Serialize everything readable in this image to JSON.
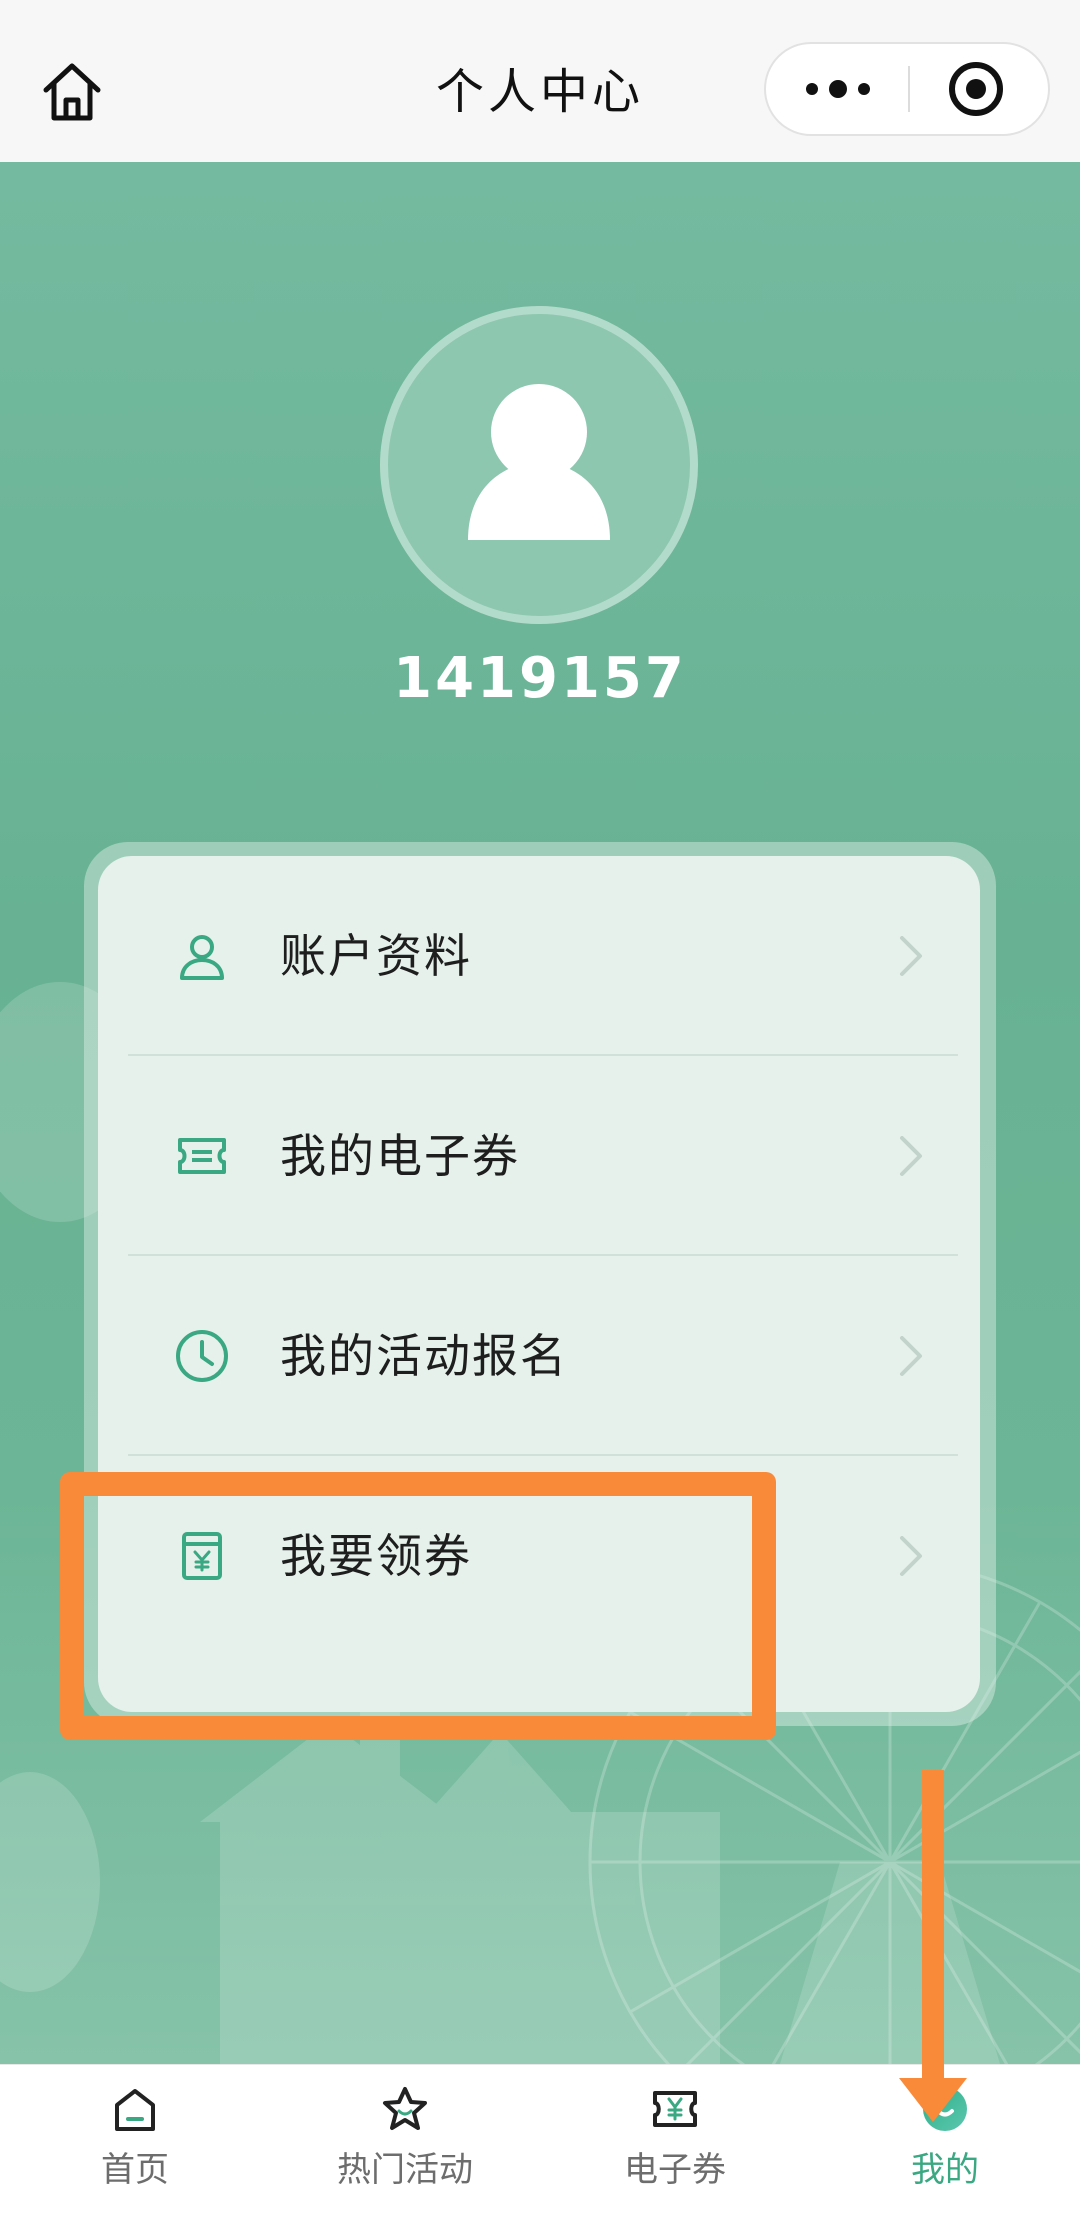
{
  "nav": {
    "title": "个人中心",
    "home_icon": "home-icon",
    "more_icon": "more-dots-icon",
    "close_icon": "target-close-icon"
  },
  "profile": {
    "avatar_icon": "user-avatar-icon",
    "user_id": "1419157"
  },
  "menu": {
    "items": [
      {
        "label": "账户资料",
        "icon": "user-outline-icon"
      },
      {
        "label": "我的电子券",
        "icon": "ticket-icon"
      },
      {
        "label": "我的活动报名",
        "icon": "clock-icon"
      },
      {
        "label": "我要领券",
        "icon": "coupon-yuan-icon"
      }
    ]
  },
  "tabbar": {
    "active_index": 3,
    "items": [
      {
        "label": "首页",
        "icon": "home-tab-icon"
      },
      {
        "label": "热门活动",
        "icon": "star-icon"
      },
      {
        "label": "电子券",
        "icon": "yuan-ticket-icon"
      },
      {
        "label": "我的",
        "icon": "smile-circle-icon"
      }
    ]
  },
  "colors": {
    "accent": "#3aa882",
    "background_green": "#6bb597",
    "annotation_orange": "#f98a3a",
    "card_bg": "#e6f1ec"
  }
}
